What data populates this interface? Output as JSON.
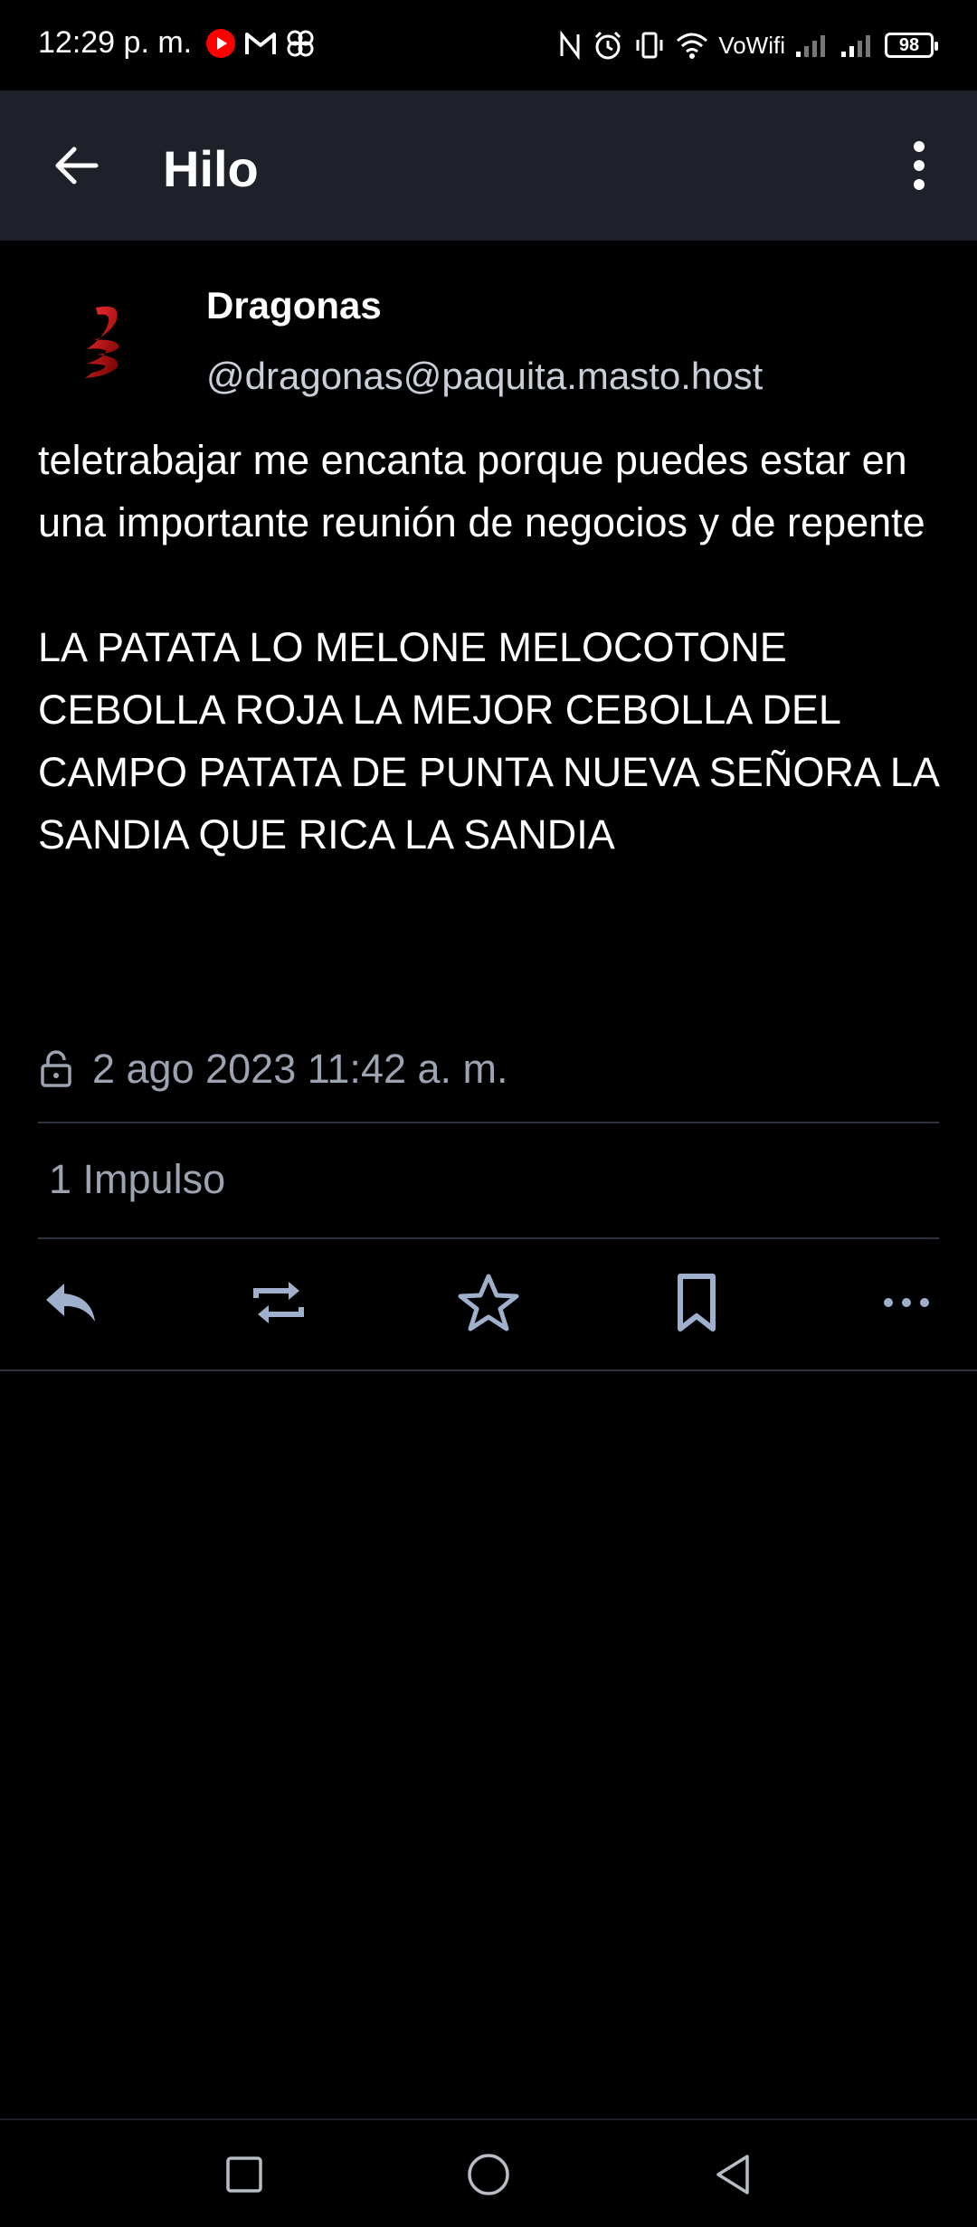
{
  "status_bar": {
    "time": "12:29 p. m.",
    "vowifi": "VoWifi",
    "battery": "98"
  },
  "top_bar": {
    "title": "Hilo"
  },
  "post": {
    "display_name": "Dragonas",
    "handle": "@dragonas@paquita.masto.host",
    "content": "teletrabajar me encanta porque puedes estar en una importante reunión de negocios y de repente\n\nLA PATATA LO MELONE MELOCOTONE CEBOLLA ROJA LA MEJOR CEBOLLA DEL CAMPO PATATA DE PUNTA NUEVA SEÑORA LA SANDIA QUE RICA LA SANDIA",
    "timestamp": "2 ago 2023 11:42 a. m.",
    "boosts_label": "1 Impulso"
  },
  "icons": {
    "back": "arrow-left-icon",
    "menu": "more-vertical-icon",
    "visibility": "lock-open-icon",
    "reply": "reply-icon",
    "boost": "repeat-icon",
    "favourite": "star-icon",
    "bookmark": "bookmark-icon",
    "more": "more-horizontal-icon"
  },
  "colors": {
    "background": "#000000",
    "toolbar": "#1e2129",
    "muted_text": "#9ca3b2",
    "icon": "#9fb0cc",
    "divider": "#2f333d"
  }
}
